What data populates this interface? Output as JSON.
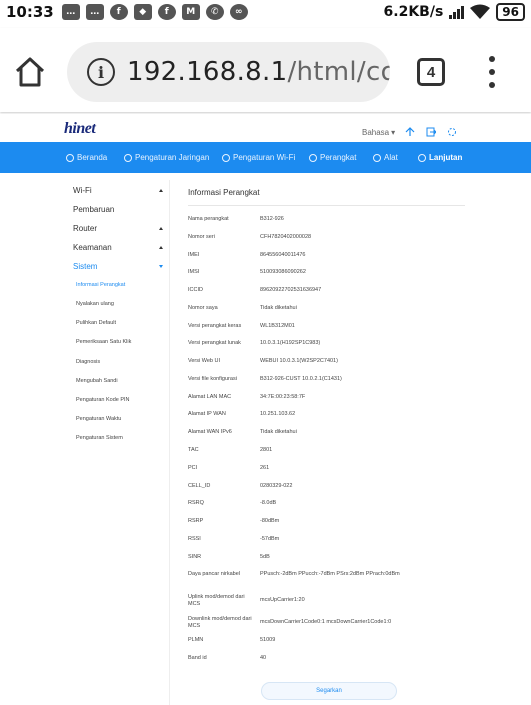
{
  "statusbar": {
    "time": "10:33",
    "speed": "6.2KB/s",
    "battery": "96",
    "notification_icons": [
      "messages-icon",
      "messages-icon",
      "facebook-icon",
      "maps-icon",
      "facebook-icon",
      "app-icon",
      "whatsapp-icon",
      "tripadvisor-icon"
    ]
  },
  "browser": {
    "url_host": "192.168.8.1",
    "url_path": "/html/conte",
    "tab_count": "4"
  },
  "header": {
    "logo": "hinet",
    "language": "Bahasa"
  },
  "nav": {
    "items": [
      {
        "label": "Beranda"
      },
      {
        "label": "Pengaturan Jaringan"
      },
      {
        "label": "Pengaturan Wi-Fi"
      },
      {
        "label": "Perangkat"
      },
      {
        "label": "Alat"
      },
      {
        "label": "Lanjutan"
      }
    ]
  },
  "sidebar": {
    "sections": [
      {
        "label": "Wi-Fi"
      },
      {
        "label": "Pembaruan"
      },
      {
        "label": "Router"
      },
      {
        "label": "Keamanan"
      },
      {
        "label": "Sistem"
      }
    ],
    "subitems": [
      {
        "label": "Informasi Perangkat"
      },
      {
        "label": "Nyalakan ulang"
      },
      {
        "label": "Pulihkan Default"
      },
      {
        "label": "Pemeriksaan Satu Klik"
      },
      {
        "label": "Diagnosis"
      },
      {
        "label": "Mengubah Sandi"
      },
      {
        "label": "Pengaturan Kode PIN"
      },
      {
        "label": "Pengaturan Waktu"
      },
      {
        "label": "Pengaturan Sistem"
      }
    ]
  },
  "content": {
    "title": "Informasi Perangkat",
    "rows": [
      {
        "key": "Nama perangkat",
        "value": "B312-926"
      },
      {
        "key": "Nomor seri",
        "value": "CFH7820402000028"
      },
      {
        "key": "IMEI",
        "value": "864556040011476"
      },
      {
        "key": "IMSI",
        "value": "510093086090262"
      },
      {
        "key": "ICCID",
        "value": "89620922702531636947"
      },
      {
        "key": "Nomor saya",
        "value": "Tidak diketahui"
      },
      {
        "key": "Versi perangkat keras",
        "value": "WL1B312M01"
      },
      {
        "key": "Versi perangkat lunak",
        "value": "10.0.3.1(H192SP1C983)"
      },
      {
        "key": "Versi Web UI",
        "value": "WEBUI 10.0.3.1(W2SP2C7401)"
      },
      {
        "key": "Versi file konfigurasi",
        "value": "B312-926-CUST 10.0.2.1(C1431)"
      },
      {
        "key": "Alamat LAN MAC",
        "value": "34:7E:00:23:58:7F"
      },
      {
        "key": "Alamat IP WAN",
        "value": "10.251.103.62"
      },
      {
        "key": "Alamat WAN IPv6",
        "value": "Tidak diketahui"
      },
      {
        "key": "TAC",
        "value": "2801"
      },
      {
        "key": "PCI",
        "value": "261"
      },
      {
        "key": "CELL_ID",
        "value": "0280329-022"
      },
      {
        "key": "RSRQ",
        "value": "-8.0dB"
      },
      {
        "key": "RSRP",
        "value": "-80dBm"
      },
      {
        "key": "RSSI",
        "value": "-57dBm"
      },
      {
        "key": "SINR",
        "value": "5dB"
      },
      {
        "key": "Daya pancar nirkabel",
        "value": "PPusch:-2dBm PPucch:-7dBm PSrs:2dBm PPrach:0dBm"
      },
      {
        "key": "Uplink mod/demod dari MCS",
        "value": "mcsUpCarrier1:20"
      },
      {
        "key": "Downlink mod/demod dari MCS",
        "value": "mcsDownCarrier1Code0:1 mcsDownCarrier1Code1:0"
      },
      {
        "key": "PLMN",
        "value": "51009"
      },
      {
        "key": "Band id",
        "value": "40"
      }
    ],
    "save_label": "Segarkan"
  },
  "colors": {
    "accent": "#1c8bf0",
    "nav_bg": "#1c8bf0"
  }
}
